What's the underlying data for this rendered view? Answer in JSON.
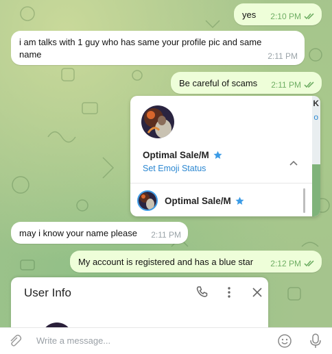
{
  "messages": [
    {
      "text": "yes",
      "time": "2:10 PM",
      "direction": "out",
      "read": true
    },
    {
      "text_line1": "i am talks with 1 guy who has same your profile pic and same",
      "text_line2": "name",
      "time": "2:11 PM",
      "direction": "in"
    },
    {
      "text": "Be careful of scams",
      "time": "2:11 PM",
      "direction": "out",
      "read": true
    },
    {
      "text": "may i know your name please",
      "time": "2:11 PM",
      "direction": "in"
    },
    {
      "text": "My account is registered and has a blue star",
      "time": "2:12 PM",
      "direction": "out",
      "read": true
    }
  ],
  "profile_card": {
    "name": "Optimal Sale/M",
    "emoji_status_link": "Set Emoji Status",
    "account_row_name": "Optimal Sale/M",
    "edge_text_top": "K",
    "edge_text_sub": "o",
    "star_icon": "blue-star-icon"
  },
  "user_info": {
    "title": "User Info"
  },
  "composer": {
    "placeholder": "Write a message..."
  },
  "colors": {
    "outgoing_bubble": "#eefed9",
    "incoming_bubble": "#ffffff",
    "link_blue": "#2b87d1",
    "check_green": "#6fae64",
    "star_blue": "#3b9be6"
  }
}
